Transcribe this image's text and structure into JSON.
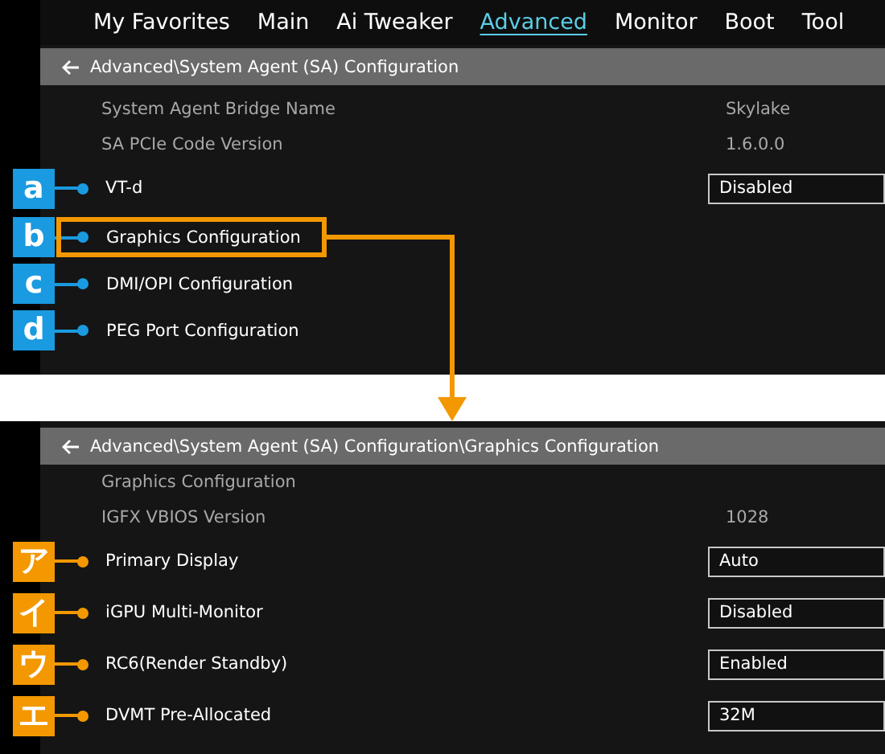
{
  "panels": [
    {
      "tabs": [
        {
          "label": "My Favorites",
          "selected": false
        },
        {
          "label": "Main",
          "selected": false
        },
        {
          "label": "Ai Tweaker",
          "selected": false
        },
        {
          "label": "Advanced",
          "selected": true
        },
        {
          "label": "Monitor",
          "selected": false
        },
        {
          "label": "Boot",
          "selected": false
        },
        {
          "label": "Tool",
          "selected": false
        }
      ],
      "breadcrumb": "Advanced\\System Agent (SA) Configuration",
      "info_rows": [
        {
          "label": "System Agent Bridge Name",
          "value": "Skylake"
        },
        {
          "label": "SA PCIe Code Version",
          "value": "1.6.0.0"
        }
      ],
      "settings": [
        {
          "kind": "dropdown",
          "badge": "a",
          "color": "#1a9ae0",
          "label": "VT-d",
          "value": "Disabled",
          "highlighted": false
        },
        {
          "kind": "submenu",
          "badge": "b",
          "color": "#1a9ae0",
          "label": "Graphics Configuration",
          "highlighted": true
        },
        {
          "kind": "submenu",
          "badge": "c",
          "color": "#1a9ae0",
          "label": "DMI/OPI Configuration",
          "highlighted": false
        },
        {
          "kind": "submenu",
          "badge": "d",
          "color": "#1a9ae0",
          "label": "PEG Port Configuration",
          "highlighted": false
        }
      ]
    },
    {
      "breadcrumb": "Advanced\\System Agent (SA) Configuration\\Graphics Configuration",
      "info_rows": [
        {
          "label": "Graphics Configuration"
        },
        {
          "label": "IGFX VBIOS Version",
          "value": "1028"
        }
      ],
      "settings": [
        {
          "kind": "dropdown",
          "badge": "ア",
          "color": "#f39800",
          "label": "Primary Display",
          "value": "Auto",
          "highlighted": false
        },
        {
          "kind": "dropdown",
          "badge": "イ",
          "color": "#f39800",
          "label": "iGPU Multi-Monitor",
          "value": "Disabled",
          "highlighted": false
        },
        {
          "kind": "dropdown",
          "badge": "ウ",
          "color": "#f39800",
          "label": "RC6(Render Standby)",
          "value": "Enabled",
          "highlighted": false
        },
        {
          "kind": "dropdown",
          "badge": "エ",
          "color": "#f39800",
          "label": "DVMT Pre-Allocated",
          "value": "32M",
          "highlighted": false
        }
      ]
    }
  ]
}
